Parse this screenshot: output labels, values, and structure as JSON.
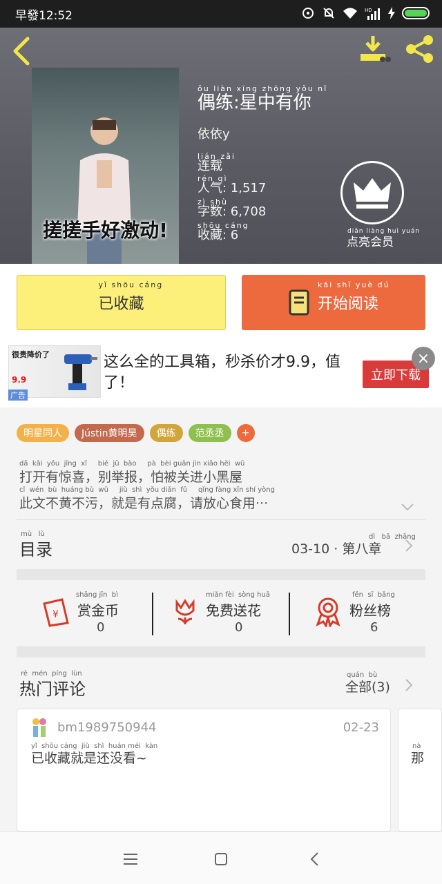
{
  "status_bar": {
    "time": "早發12:52"
  },
  "header": {
    "title": "偶练:星中有你",
    "title_pinyin": "ǒu  liàn   xīng zhōng yǒu  nǐ",
    "author": "依依y",
    "status_pinyin": "lián  zǎi",
    "status": "连载",
    "popularity": "人气: 1,517",
    "popularity_pinyin": "rén  qì",
    "word_count": "字数: 6,708",
    "word_count_pinyin": "zì  shù",
    "favorites": "收藏: 6",
    "favorites_pinyin": "shōu cáng",
    "cover_caption": "搓搓手好激动!",
    "vip_label": "点亮会员",
    "vip_pinyin": "diǎn liàng  huì  yuán"
  },
  "actions": {
    "collect_label": "已收藏",
    "collect_pinyin": "yǐ   shōu cáng",
    "read_label": "开始阅读",
    "read_pinyin": "kāi  shǐ   yuè  dú"
  },
  "ad": {
    "image_title": "很贵降价了",
    "image_price": "9.9",
    "badge": "广告",
    "text": "这么全的工具箱，秒杀价才9.9，值了！",
    "cta": "立即下载",
    "close": "×"
  },
  "tags": [
    {
      "label": "明星同人",
      "color": "#f2b14a"
    },
    {
      "label": "Jústin黄明昊",
      "color": "#c2694e"
    },
    {
      "label": "偶练",
      "color": "#d0a63a"
    },
    {
      "label": "范丞丞",
      "color": "#8fbf4e"
    }
  ],
  "tag_add": "+",
  "description": {
    "line1_pinyin": "dǎ  kāi  yǒu  jīng  xǐ     bié  jǔ  bào     pà  bèi guān jìn xiǎo hēi  wū",
    "line1": "打开有惊喜，别举报，怕被关进小黑屋",
    "line2_pinyin": "cǐ  wén  bù  huáng bù  wū     jiù  shì  yǒu diǎn  fǔ     qǐng fàng xīn shí yòng",
    "line2": "此文不黄不污，就是有点腐，请放心食用···"
  },
  "toc": {
    "label": "目录",
    "label_pinyin": "mù   lù",
    "latest": "03-10 · 第八章",
    "latest_pinyin": "dì   bā  zhāng"
  },
  "stats": [
    {
      "label": "赏金币",
      "pinyin": "shǎng jīn  bì",
      "value": "0"
    },
    {
      "label": "免费送花",
      "pinyin": "miǎn fèi  sòng huā",
      "value": "0"
    },
    {
      "label": "粉丝榜",
      "pinyin": "fěn  sī  bǎng",
      "value": "6"
    }
  ],
  "hot_comments": {
    "title": "热门评论",
    "title_pinyin": "rè  mén  píng  lùn",
    "all": "全部(3)",
    "all_pinyin": "quán  bù",
    "items": [
      {
        "user": "bm1989750944",
        "date": "02-23",
        "text": "已收藏就是还没看~",
        "text_pinyin": "yǐ  shōu cáng  jiù  shì  huán méi  kàn"
      }
    ],
    "next_preview": "那",
    "next_preview_pinyin": "nà"
  }
}
